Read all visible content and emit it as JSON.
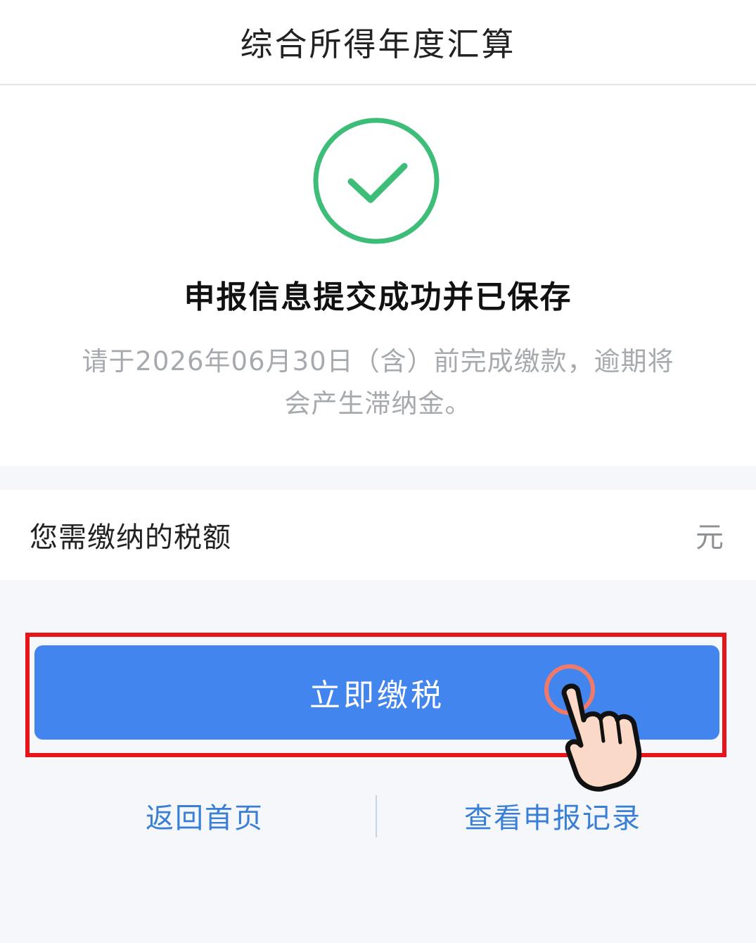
{
  "header": {
    "title": "综合所得年度汇算"
  },
  "result": {
    "status_icon": "check-circle-icon",
    "title": "申报信息提交成功并已保存",
    "note_line1": "请于2026年06月30日（含）前完成缴款，逾期将",
    "note_line2": "会产生滞纳金。"
  },
  "tax": {
    "label": "您需缴纳的税额",
    "amount": "",
    "unit": "元"
  },
  "actions": {
    "pay_label": "立即缴税",
    "home_label": "返回首页",
    "records_label": "查看申报记录"
  },
  "colors": {
    "accent": "#4385ef",
    "success": "#3dbd78",
    "highlight": "#e8141c",
    "link": "#3a7fd6"
  }
}
